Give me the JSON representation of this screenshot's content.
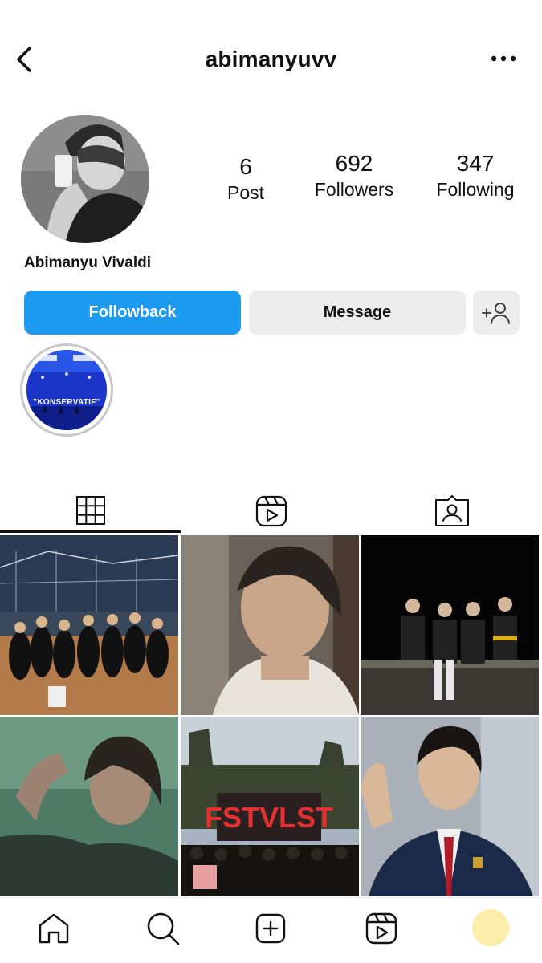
{
  "header": {
    "username": "abimanyuvv"
  },
  "profile": {
    "full_name": "Abimanyu Vivaldi",
    "stats": {
      "posts_count": "6",
      "posts_label": "Post",
      "followers_count": "692",
      "followers_label": "Followers",
      "following_count": "347",
      "following_label": "Following"
    }
  },
  "actions": {
    "follow_label": "Followback",
    "message_label": "Message"
  },
  "highlights": [
    {
      "label": "\"KONSERVATIF\""
    }
  ],
  "tabs": [
    {
      "icon": "grid-icon",
      "active": true
    },
    {
      "icon": "reels-icon",
      "active": false
    },
    {
      "icon": "tagged-icon",
      "active": false
    }
  ],
  "posts": [
    {
      "subject": "group-photo-basketball-court"
    },
    {
      "subject": "portrait-closeup"
    },
    {
      "subject": "group-night-photo"
    },
    {
      "subject": "portrait-green-tint"
    },
    {
      "subject": "concert-stage"
    },
    {
      "subject": "school-uniform-portrait"
    }
  ],
  "bottom_nav": {
    "items": [
      "home-icon",
      "search-icon",
      "create-icon",
      "reels-icon",
      "profile-avatar"
    ],
    "avatar_color": "#fbeeaa"
  },
  "colors": {
    "accent": "#1c9bf0",
    "secondary_button": "#ececec"
  }
}
